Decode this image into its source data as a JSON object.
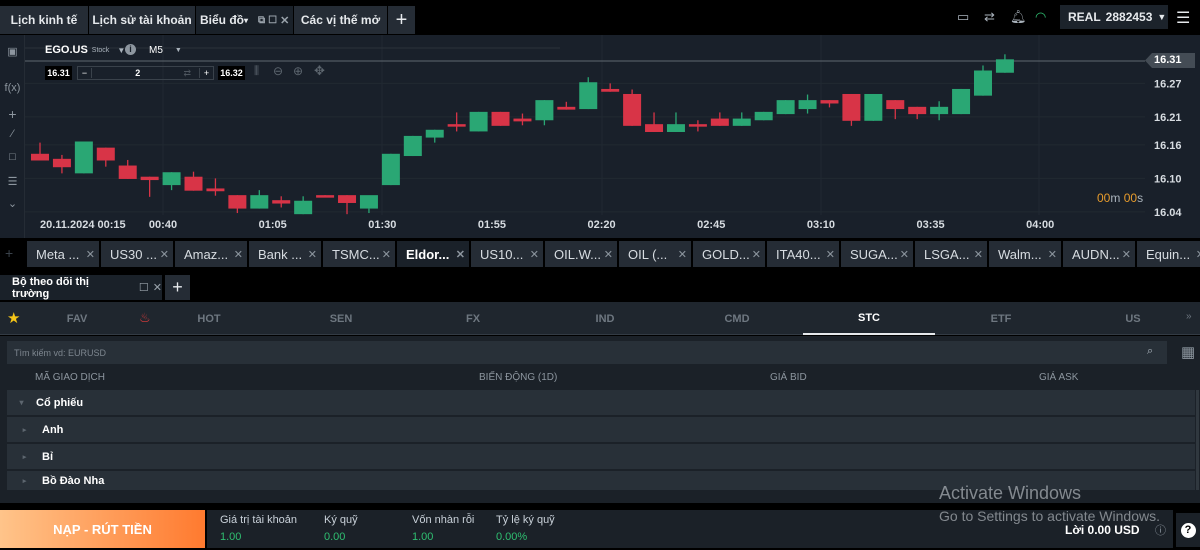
{
  "top_tabs": [
    {
      "label": "Lịch kinh tế"
    },
    {
      "label": "Lịch sử tài khoản"
    },
    {
      "label": "Biểu đồ",
      "active": true
    },
    {
      "label": "Các vị thế mở"
    }
  ],
  "add_tab": "+",
  "account": {
    "type": "REAL",
    "number": "2882453"
  },
  "chart_toolbar": {
    "symbol": "EGO.US",
    "symbol_type": "Stock",
    "timeframe": "M5",
    "bid": "16.31",
    "ask": "16.32",
    "quantity": "2"
  },
  "chart_data": {
    "type": "candlestick",
    "x_tick_labels": [
      "20.11.2024 00:15",
      "00:40",
      "01:05",
      "01:30",
      "01:55",
      "02:20",
      "02:45",
      "03:10",
      "03:35",
      "04:00"
    ],
    "y_tick_labels": [
      "16.27",
      "16.21",
      "16.16",
      "16.10",
      "16.04"
    ],
    "current_price": "16.31",
    "countdown": {
      "minutes": "00",
      "m": "m",
      "seconds": "00",
      "s": "s"
    },
    "ylim": [
      16.04,
      16.33
    ],
    "interval": "M5",
    "colors": {
      "up": "#2aa774",
      "down": "#d83447"
    },
    "ohlc": [
      [
        16.144,
        16.164,
        16.132,
        16.132
      ],
      [
        16.135,
        16.142,
        16.109,
        16.12
      ],
      [
        16.109,
        16.166,
        16.109,
        16.166
      ],
      [
        16.155,
        16.155,
        16.121,
        16.132
      ],
      [
        16.123,
        16.133,
        16.099,
        16.099
      ],
      [
        16.103,
        16.103,
        16.067,
        16.097
      ],
      [
        16.088,
        16.111,
        16.079,
        16.111
      ],
      [
        16.103,
        16.112,
        16.078,
        16.078
      ],
      [
        16.082,
        16.1,
        16.069,
        16.077
      ],
      [
        16.07,
        16.07,
        16.038,
        16.046
      ],
      [
        16.046,
        16.079,
        16.046,
        16.07
      ],
      [
        16.061,
        16.068,
        16.048,
        16.055
      ],
      [
        16.036,
        16.068,
        16.036,
        16.06
      ],
      [
        16.07,
        16.07,
        16.066,
        16.066
      ],
      [
        16.07,
        16.07,
        16.036,
        16.056
      ],
      [
        16.046,
        16.046,
        16.038,
        16.07
      ],
      [
        16.088,
        16.144,
        16.088,
        16.144
      ],
      [
        16.14,
        16.176,
        16.14,
        16.176
      ],
      [
        16.173,
        16.187,
        16.164,
        16.187
      ],
      [
        16.197,
        16.218,
        16.184,
        16.193
      ],
      [
        16.184,
        16.219,
        16.184,
        16.219
      ],
      [
        16.219,
        16.219,
        16.194,
        16.194
      ],
      [
        16.207,
        16.216,
        16.195,
        16.202
      ],
      [
        16.204,
        16.24,
        16.195,
        16.24
      ],
      [
        16.228,
        16.237,
        16.223,
        16.223
      ],
      [
        16.224,
        16.281,
        16.224,
        16.272
      ],
      [
        16.26,
        16.27,
        16.255,
        16.255
      ],
      [
        16.251,
        16.259,
        16.194,
        16.194
      ],
      [
        16.197,
        16.218,
        16.183,
        16.183
      ],
      [
        16.183,
        16.218,
        16.183,
        16.197
      ],
      [
        16.197,
        16.204,
        16.184,
        16.193
      ],
      [
        16.207,
        16.218,
        16.194,
        16.194
      ],
      [
        16.194,
        16.218,
        16.194,
        16.207
      ],
      [
        16.204,
        16.219,
        16.204,
        16.219
      ],
      [
        16.215,
        16.24,
        16.215,
        16.24
      ],
      [
        16.224,
        16.25,
        16.216,
        16.24
      ],
      [
        16.24,
        16.24,
        16.227,
        16.234
      ],
      [
        16.251,
        16.251,
        16.194,
        16.203
      ],
      [
        16.203,
        16.251,
        16.203,
        16.251
      ],
      [
        16.24,
        16.24,
        16.206,
        16.224
      ],
      [
        16.228,
        16.228,
        16.206,
        16.215
      ],
      [
        16.215,
        16.238,
        16.204,
        16.228
      ],
      [
        16.215,
        16.26,
        16.215,
        16.26
      ],
      [
        16.248,
        16.302,
        16.248,
        16.293
      ],
      [
        16.289,
        16.322,
        16.289,
        16.313
      ]
    ]
  },
  "symbol_tabs": [
    {
      "label": "Meta ..."
    },
    {
      "label": "US30 ..."
    },
    {
      "label": "Amaz..."
    },
    {
      "label": "Bank ..."
    },
    {
      "label": "TSMC..."
    },
    {
      "label": "Eldor...",
      "active": true
    },
    {
      "label": "US10..."
    },
    {
      "label": "OIL.W..."
    },
    {
      "label": "OIL (..."
    },
    {
      "label": "GOLD..."
    },
    {
      "label": "ITA40..."
    },
    {
      "label": "SUGA..."
    },
    {
      "label": "LSGA..."
    },
    {
      "label": "Walm..."
    },
    {
      "label": "AUDN..."
    },
    {
      "label": "Equin..."
    }
  ],
  "watchlist": {
    "title": "Bộ theo dõi thị trường",
    "categories": [
      "FAV",
      "HOT",
      "SEN",
      "FX",
      "IND",
      "CMD",
      "STC",
      "ETF",
      "US"
    ],
    "active_category": "STC",
    "search_placeholder": "Tìm kiếm vd: EURUSD",
    "columns": [
      "MÃ GIAO DỊCH",
      "BIẾN ĐỘNG (1D)",
      "GIÁ BID",
      "GIÁ ASK"
    ],
    "group": "Cổ phiếu",
    "rows": [
      "Anh",
      "Bỉ",
      "Bồ Đào Nha"
    ]
  },
  "footer": {
    "deposit_button": "NẠP - RÚT TIỀN",
    "stats": [
      {
        "label": "Giá trị tài khoản",
        "value": "1.00"
      },
      {
        "label": "Ký quỹ",
        "value": "0.00"
      },
      {
        "label": "Vốn nhàn rỗi",
        "value": "1.00"
      },
      {
        "label": "Tỷ lệ ký quỹ",
        "value": "0.00%"
      }
    ],
    "profit": "Lời 0.00 USD"
  },
  "watermark": {
    "title": "Activate Windows",
    "subtitle": "Go to Settings to activate Windows."
  }
}
